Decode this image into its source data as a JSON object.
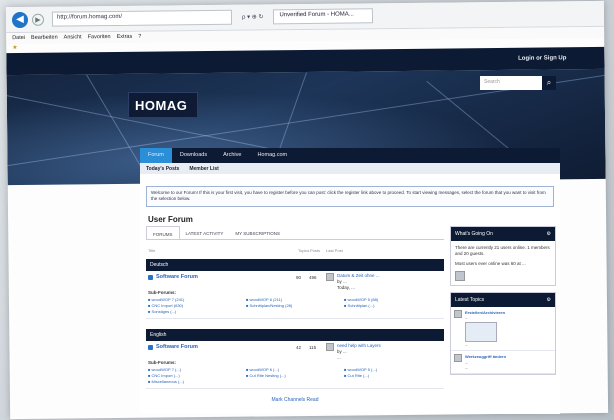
{
  "browser": {
    "url": "http://forum.homag.com/",
    "tab_title": "Unverified Forum - HOMA...",
    "controls": "ρ ▾ ⊕ ↻",
    "menu": [
      "Datei",
      "Bearbeiten",
      "Ansicht",
      "Favoriten",
      "Extras",
      "?"
    ]
  },
  "site": {
    "login": "Login or Sign Up",
    "logo": "HOMAG",
    "search_placeholder": "Search",
    "nav": [
      "Forum",
      "Downloads",
      "Archive",
      "Homag.com"
    ],
    "subnav": [
      "Today's Posts",
      "Member List"
    ],
    "notice": "Welcome to our Forum! If this is your first visit, you have to register before you can post: click the register link above to proceed. To start viewing messages, select the forum that you want to visit from the selection below.",
    "title": "User Forum"
  },
  "forum": {
    "tabs": [
      "FORUMS",
      "LATEST ACTIVITY",
      "MY SUBSCRIPTIONS"
    ],
    "columns": [
      "Title",
      "Topics",
      "Posts",
      "Last Post"
    ],
    "sections": [
      {
        "name": "Deutsch",
        "forum": "Software Forum",
        "topics": "90",
        "posts": "496",
        "last_title": "Datum & Zeit ohne ...",
        "last_by": "by ...",
        "last_date": "Today, ...",
        "subforums_label": "Sub-Forums:",
        "subforums": [
          "woodWOP 7 (241)",
          "CNC Import (630)",
          "Sonstiges (...)",
          "woodWOP 6 (211)",
          "Schnittplan/Nesting (28)",
          "",
          "woodWOP 5 (88)",
          "Schnittplan (...)",
          ""
        ]
      },
      {
        "name": "English",
        "forum": "Software Forum",
        "topics": "42",
        "posts": "115",
        "last_title": "need help with Layers",
        "last_by": "by ...",
        "last_date": "...",
        "subforums_label": "Sub-Forums:",
        "subforums": [
          "woodWOP 7 (...)",
          "CNC Import (...)",
          "Miscellaneous (...)",
          "woodWOP 6 (...)",
          "Cut Rite Nesting (...)",
          "",
          "woodWOP 5 (...)",
          "Cut Rite (...)",
          ""
        ]
      }
    ],
    "mark_read": "Mark Channels Read"
  },
  "sidebar": {
    "whats_on": "What's Going On",
    "online": "There are currently 21 users online. 1 members and 20 guests.",
    "most": "Most users ever online was 60 at ...",
    "latest": "Latest Topics",
    "topics": [
      {
        "title": "Erstellen/Archivieren",
        "meta": "...",
        "note": "...",
        "date": "..."
      },
      {
        "title": "Werkzeuggriff ändern",
        "meta": "...",
        "note": "...",
        "date": "..."
      }
    ]
  }
}
